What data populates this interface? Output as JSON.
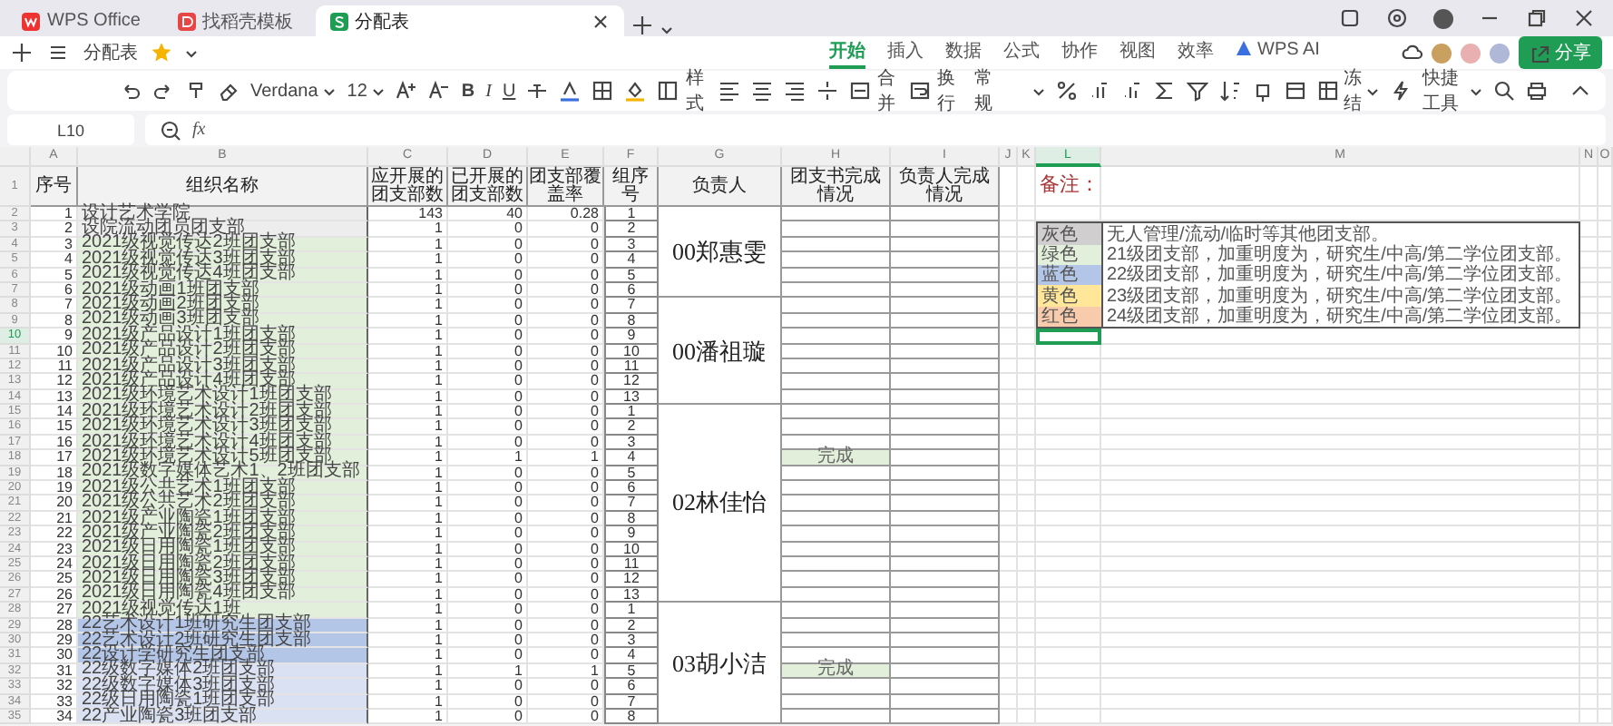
{
  "tabs": [
    {
      "label": "WPS Office",
      "selected": false
    },
    {
      "label": "找稻壳模板",
      "selected": false
    },
    {
      "label": "分配表",
      "selected": true
    }
  ],
  "document": {
    "title": "分配表",
    "starred": true
  },
  "ribbon_tabs": [
    {
      "label": "开始",
      "selected": true
    },
    {
      "label": "插入",
      "selected": false
    },
    {
      "label": "数据",
      "selected": false
    },
    {
      "label": "公式",
      "selected": false
    },
    {
      "label": "协作",
      "selected": false
    },
    {
      "label": "视图",
      "selected": false
    },
    {
      "label": "效率",
      "selected": false
    },
    {
      "label": "WPS AI",
      "selected": false
    }
  ],
  "share_button": "分享",
  "toolbar": {
    "font": "Verdana",
    "size": "12",
    "bold": "B",
    "italic": "I",
    "underline": "U",
    "styles": "样式",
    "merge": "合并",
    "wrap": "换行",
    "number_format": "常规",
    "freeze": "冻结",
    "quick_tools": "快捷工具"
  },
  "formula_bar": {
    "cell": "L10",
    "function_label": "fx"
  },
  "columns": [
    {
      "label": "A",
      "selected": false
    },
    {
      "label": "B",
      "selected": false
    },
    {
      "label": "C",
      "selected": false
    },
    {
      "label": "D",
      "selected": false
    },
    {
      "label": "E",
      "selected": false
    },
    {
      "label": "F",
      "selected": false
    },
    {
      "label": "G",
      "selected": false
    },
    {
      "label": "H",
      "selected": false
    },
    {
      "label": "I",
      "selected": false
    },
    {
      "label": "J",
      "selected": false
    },
    {
      "label": "K",
      "selected": false
    },
    {
      "label": "L",
      "selected": true
    },
    {
      "label": "M",
      "selected": false
    },
    {
      "label": "N",
      "selected": false
    },
    {
      "label": "O",
      "selected": false
    }
  ],
  "row_numbers": [
    {
      "label": "1",
      "selected": false
    },
    {
      "label": "2",
      "selected": false
    },
    {
      "label": "3",
      "selected": false
    },
    {
      "label": "4",
      "selected": false
    },
    {
      "label": "5",
      "selected": false
    },
    {
      "label": "6",
      "selected": false
    },
    {
      "label": "7",
      "selected": false
    },
    {
      "label": "8",
      "selected": false
    },
    {
      "label": "9",
      "selected": false
    },
    {
      "label": "10",
      "selected": true
    },
    {
      "label": "11",
      "selected": false
    },
    {
      "label": "12",
      "selected": false
    },
    {
      "label": "13",
      "selected": false
    },
    {
      "label": "14",
      "selected": false
    },
    {
      "label": "15",
      "selected": false
    },
    {
      "label": "16",
      "selected": false
    },
    {
      "label": "17",
      "selected": false
    },
    {
      "label": "18",
      "selected": false
    },
    {
      "label": "19",
      "selected": false
    },
    {
      "label": "20",
      "selected": false
    },
    {
      "label": "21",
      "selected": false
    },
    {
      "label": "22",
      "selected": false
    },
    {
      "label": "23",
      "selected": false
    },
    {
      "label": "24",
      "selected": false
    },
    {
      "label": "25",
      "selected": false
    },
    {
      "label": "26",
      "selected": false
    },
    {
      "label": "27",
      "selected": false
    },
    {
      "label": "28",
      "selected": false
    },
    {
      "label": "29",
      "selected": false
    },
    {
      "label": "30",
      "selected": false
    },
    {
      "label": "31",
      "selected": false
    },
    {
      "label": "32",
      "selected": false
    },
    {
      "label": "33",
      "selected": false
    },
    {
      "label": "34",
      "selected": false
    },
    {
      "label": "35",
      "selected": false
    }
  ],
  "headers": [
    "序号",
    "组织名称",
    "应开展的团支部数",
    "已开展的团支部数",
    "团支部覆盖率",
    "组序号",
    "负责人",
    "团支书完成情况",
    "负责人完成情况"
  ],
  "groups": [
    {
      "leader": "00郑惠雯",
      "rows": [
        {
          "seq": "1",
          "name": "设计艺术学院",
          "planned": "143",
          "opened": "40",
          "rate": "0.28",
          "group_no": "1",
          "color": "#ededed"
        },
        {
          "seq": "2",
          "name": "设院流动团员团支部",
          "planned": "1",
          "opened": "0",
          "rate": "0",
          "group_no": "2",
          "color": "#ededed"
        },
        {
          "seq": "3",
          "name": "2021级视觉传达2班团支部",
          "planned": "1",
          "opened": "0",
          "rate": "0",
          "group_no": "3",
          "color": "#e2efda"
        },
        {
          "seq": "4",
          "name": "2021级视觉传达3班团支部",
          "planned": "1",
          "opened": "0",
          "rate": "0",
          "group_no": "4",
          "color": "#e2efda"
        },
        {
          "seq": "5",
          "name": "2021级视觉传达4班团支部",
          "planned": "1",
          "opened": "0",
          "rate": "0",
          "group_no": "5",
          "color": "#e2efda"
        },
        {
          "seq": "6",
          "name": "2021级动画1班团支部",
          "planned": "1",
          "opened": "0",
          "rate": "0",
          "group_no": "6",
          "color": "#e2efda"
        }
      ]
    },
    {
      "leader": "00潘祖璇",
      "rows": [
        {
          "seq": "7",
          "name": "2021级动画2班团支部",
          "planned": "1",
          "opened": "0",
          "rate": "0",
          "group_no": "7",
          "color": "#e2efda"
        },
        {
          "seq": "8",
          "name": "2021级动画3班团支部",
          "planned": "1",
          "opened": "0",
          "rate": "0",
          "group_no": "8",
          "color": "#e2efda"
        },
        {
          "seq": "9",
          "name": "2021级产品设计1班团支部",
          "planned": "1",
          "opened": "0",
          "rate": "0",
          "group_no": "9",
          "color": "#e2efda"
        },
        {
          "seq": "10",
          "name": "2021级产品设计2班团支部",
          "planned": "1",
          "opened": "0",
          "rate": "0",
          "group_no": "10",
          "color": "#e2efda"
        },
        {
          "seq": "11",
          "name": "2021级产品设计3班团支部",
          "planned": "1",
          "opened": "0",
          "rate": "0",
          "group_no": "11",
          "color": "#e2efda"
        },
        {
          "seq": "12",
          "name": "2021级产品设计4班团支部",
          "planned": "1",
          "opened": "0",
          "rate": "0",
          "group_no": "12",
          "color": "#e2efda"
        },
        {
          "seq": "13",
          "name": "2021级环境艺术设计1班团支部",
          "planned": "1",
          "opened": "0",
          "rate": "0",
          "group_no": "13",
          "color": "#e2efda"
        }
      ]
    },
    {
      "leader": "02林佳怡",
      "rows": [
        {
          "seq": "14",
          "name": "2021级环境艺术设计2班团支部",
          "planned": "1",
          "opened": "0",
          "rate": "0",
          "group_no": "1",
          "color": "#e2efda"
        },
        {
          "seq": "15",
          "name": "2021级环境艺术设计3班团支部",
          "planned": "1",
          "opened": "0",
          "rate": "0",
          "group_no": "2",
          "color": "#e2efda"
        },
        {
          "seq": "16",
          "name": "2021级环境艺术设计4班团支部",
          "planned": "1",
          "opened": "0",
          "rate": "0",
          "group_no": "3",
          "color": "#e2efda"
        },
        {
          "seq": "17",
          "name": "2021级环境艺术设计5班团支部",
          "planned": "1",
          "opened": "1",
          "rate": "1",
          "group_no": "4",
          "color": "#e2efda",
          "status": "完成"
        },
        {
          "seq": "18",
          "name": "2021级数字媒体艺术1、2班团支部",
          "planned": "1",
          "opened": "0",
          "rate": "0",
          "group_no": "5",
          "color": "#e2efda"
        },
        {
          "seq": "19",
          "name": "2021级公共艺术1班团支部",
          "planned": "1",
          "opened": "0",
          "rate": "0",
          "group_no": "6",
          "color": "#e2efda"
        },
        {
          "seq": "20",
          "name": "2021级公共艺术2班团支部",
          "planned": "1",
          "opened": "0",
          "rate": "0",
          "group_no": "7",
          "color": "#e2efda"
        },
        {
          "seq": "21",
          "name": "2021级产业陶瓷1班团支部",
          "planned": "1",
          "opened": "0",
          "rate": "0",
          "group_no": "8",
          "color": "#e2efda"
        },
        {
          "seq": "22",
          "name": "2021级产业陶瓷2班团支部",
          "planned": "1",
          "opened": "0",
          "rate": "0",
          "group_no": "9",
          "color": "#e2efda"
        },
        {
          "seq": "23",
          "name": "2021级日用陶瓷1班团支部",
          "planned": "1",
          "opened": "0",
          "rate": "0",
          "group_no": "10",
          "color": "#e2efda"
        },
        {
          "seq": "24",
          "name": "2021级日用陶瓷2班团支部",
          "planned": "1",
          "opened": "0",
          "rate": "0",
          "group_no": "11",
          "color": "#e2efda"
        },
        {
          "seq": "25",
          "name": "2021级日用陶瓷3班团支部",
          "planned": "1",
          "opened": "0",
          "rate": "0",
          "group_no": "12",
          "color": "#e2efda"
        },
        {
          "seq": "26",
          "name": "2021级日用陶瓷4班团支部",
          "planned": "1",
          "opened": "0",
          "rate": "0",
          "group_no": "13",
          "color": "#e2efda"
        }
      ]
    },
    {
      "leader": "03胡小洁",
      "rows": [
        {
          "seq": "27",
          "name": "2021级视觉传达1班",
          "planned": "1",
          "opened": "0",
          "rate": "0",
          "group_no": "1",
          "color": "#e2efda"
        },
        {
          "seq": "28",
          "name": "22艺术设计1班研究生团支部",
          "planned": "1",
          "opened": "0",
          "rate": "0",
          "group_no": "2",
          "color": "#b4c6e7"
        },
        {
          "seq": "29",
          "name": "22艺术设计2班研究生团支部",
          "planned": "1",
          "opened": "0",
          "rate": "0",
          "group_no": "3",
          "color": "#b4c6e7"
        },
        {
          "seq": "30",
          "name": "22设计学研究生团支部",
          "planned": "1",
          "opened": "0",
          "rate": "0",
          "group_no": "4",
          "color": "#b4c6e7"
        },
        {
          "seq": "31",
          "name": "22级数字媒体2班团支部",
          "planned": "1",
          "opened": "1",
          "rate": "1",
          "group_no": "5",
          "color": "#d9e1f2",
          "status": "完成"
        },
        {
          "seq": "32",
          "name": "22级数字媒体3班团支部",
          "planned": "1",
          "opened": "0",
          "rate": "0",
          "group_no": "6",
          "color": "#d9e1f2"
        },
        {
          "seq": "33",
          "name": "22级日用陶瓷1班团支部",
          "planned": "1",
          "opened": "0",
          "rate": "0",
          "group_no": "7",
          "color": "#d9e1f2"
        },
        {
          "seq": "34",
          "name": "22产业陶瓷3班团支部",
          "planned": "1",
          "opened": "0",
          "rate": "0",
          "group_no": "8",
          "color": "#d9e1f2"
        }
      ]
    }
  ],
  "note": {
    "title": "备注：",
    "legend": [
      {
        "label": "灰色",
        "color": "#d0cece",
        "text": "无人管理/流动/临时等其他团支部。"
      },
      {
        "label": "绿色",
        "color": "#e2efda",
        "text": "21级团支部，加重明度为，研究生/中高/第二学位团支部。"
      },
      {
        "label": "蓝色",
        "color": "#b4c6e7",
        "text": "22级团支部，加重明度为，研究生/中高/第二学位团支部。"
      },
      {
        "label": "黄色",
        "color": "#ffe699",
        "text": "23级团支部，加重明度为，研究生/中高/第二学位团支部。"
      },
      {
        "label": "红色",
        "color": "#f8cbad",
        "text": "24级团支部，加重明度为，研究生/中高/第二学位团支部。"
      }
    ]
  }
}
